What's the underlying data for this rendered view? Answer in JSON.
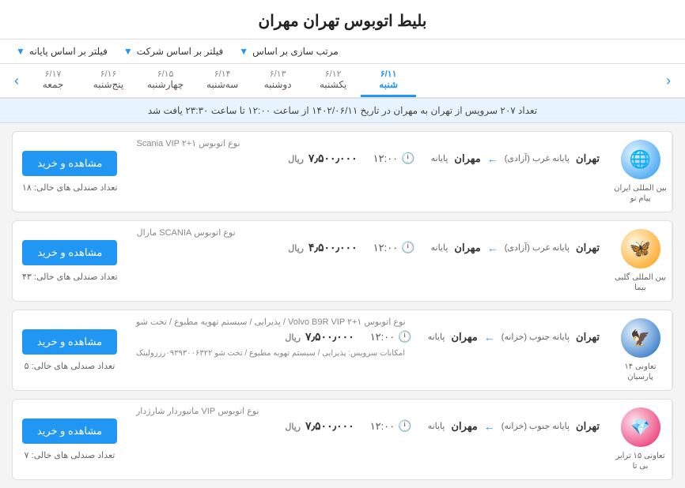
{
  "page": {
    "title": "بلیط اتوبوس تهران مهران"
  },
  "filters": {
    "sort_label": "مرتب سازی بر اساس",
    "sort_value": "",
    "company_label": "فیلتر بر اساس شرکت",
    "terminal_label": "فیلتر بر اساس پایانه"
  },
  "date_nav": {
    "prev_label": "‹",
    "next_label": "›",
    "dates": [
      {
        "day_name": "شنبه",
        "date": "۶/۱۱",
        "active": true
      },
      {
        "day_name": "یکشنبه",
        "date": "۶/۱۲",
        "active": false
      },
      {
        "day_name": "دوشنبه",
        "date": "۶/۱۳",
        "active": false
      },
      {
        "day_name": "سه‌شنبه",
        "date": "۶/۱۴",
        "active": false
      },
      {
        "day_name": "چهارشنبه",
        "date": "۶/۱۵",
        "active": false
      },
      {
        "day_name": "پنج‌شنبه",
        "date": "۶/۱۶",
        "active": false
      },
      {
        "day_name": "جمعه",
        "date": "۶/۱۷",
        "active": false
      }
    ]
  },
  "info_bar": {
    "text": "تعداد ۲۰۷ سرویس از تهران به مهران در تاریخ ۱۴۰۲/۰۶/۱۱ از ساعت ۱۲:۰۰ تا ساعت ۲۳:۳۰ یافت شد"
  },
  "tickets": [
    {
      "id": 1,
      "company_name": "بین المللی ایران پیام نو",
      "logo_type": "globe",
      "bus_type": "نوع اتوبوس Scania VIP ۲+۱",
      "from": "تهران",
      "from_terminal": "پایانه غرب (آزادی)",
      "to": "مهران",
      "to_terminal": "پایانه",
      "time": "۱۲:۰۰",
      "price": "۷٫۵۰۰٫۰۰۰",
      "currency": "ریال",
      "seats": "تعداد صندلی های خالی: ۱۸",
      "btn_label": "مشاهده و خرید",
      "amenities": ""
    },
    {
      "id": 2,
      "company_name": "بین المللی گلبی بیما",
      "logo_type": "wings",
      "bus_type": "نوع اتوبوس SCANIA مارال",
      "from": "تهران",
      "from_terminal": "پایانه غرب (آزادی)",
      "to": "مهران",
      "to_terminal": "پایانه",
      "time": "۱۲:۰۰",
      "price": "۴٫۵۰۰٫۰۰۰",
      "currency": "ریال",
      "seats": "تعداد صندلی های خالی: ۴۳",
      "btn_label": "مشاهده و خرید",
      "amenities": ""
    },
    {
      "id": 3,
      "company_name": "تعاونی ۱۴ پارسیان",
      "logo_type": "bird",
      "bus_type": "نوع اتوبوس Volvo B9R VIP ۲+۱ / پذیرایی / سیستم تهویه مطبوع / تخت شو",
      "from": "تهران",
      "from_terminal": "پایانه جنوب (خزانه)",
      "to": "مهران",
      "to_terminal": "پایانه",
      "time": "۱۲:۰۰",
      "price": "۷٫۵۰۰٫۰۰۰",
      "currency": "ریال",
      "seats": "تعداد صندلی های خالی: ۵",
      "btn_label": "مشاهده و خرید",
      "amenities": "امکانات سرویس: پذیرایی / سیستم تهویه مطبوع / تخت شو  ۰۹۳۹۳۰۰۶۳۲۲رزرولینک"
    },
    {
      "id": 4,
      "company_name": "تعاونی ۱۵ ترابر بی تا",
      "logo_type": "diamond",
      "bus_type": "نوع اتوبوس VIP ماتیوردار شارژدار",
      "from": "تهران",
      "from_terminal": "پایانه جنوب (خزانه)",
      "to": "مهران",
      "to_terminal": "پایانه",
      "time": "۱۲:۰۰",
      "price": "۷٫۵۰۰٫۰۰۰",
      "currency": "ریال",
      "seats": "تعداد صندلی های خالی: ۷",
      "btn_label": "مشاهده و خرید",
      "amenities": ""
    }
  ]
}
